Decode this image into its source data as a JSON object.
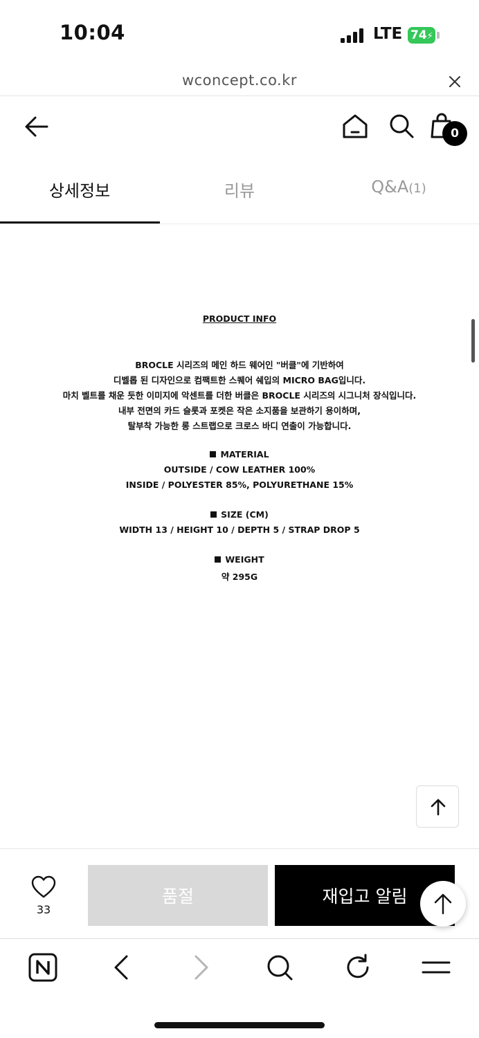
{
  "status_bar": {
    "time": "10:04",
    "network": "LTE",
    "battery": "74"
  },
  "browser": {
    "url": "wconcept.co.kr"
  },
  "header": {
    "cart_count": "0"
  },
  "tabs": [
    {
      "label": "상세정보",
      "active": true
    },
    {
      "label": "리뷰",
      "active": false
    },
    {
      "label": "Q&A",
      "count": "(1)",
      "active": false
    }
  ],
  "product_info": {
    "title": "PRODUCT INFO",
    "description": [
      "BROCLE 시리즈의 메인 하드 웨어인 \"버클\"에 기반하여",
      "디벨롭 된 디자인으로 컴팩트한 스퀘어 쉐입의 MICRO BAG입니다.",
      "마치 벨트를 채운 듯한 이미지에 악센트를 더한 버클은 BROCLE 시리즈의 시그니처 장식입니다.",
      "내부 전면의 카드 슬롯과 포켓은 작은 소지품을 보관하기 용이하며,",
      "탈부착 가능한 롱 스트랩으로 크로스 바디 연출이 가능합니다."
    ],
    "material": {
      "heading": "MATERIAL",
      "lines": [
        "OUTSIDE / COW LEATHER 100%",
        "INSIDE / POLYESTER 85%, POLYURETHANE 15%"
      ]
    },
    "size": {
      "heading": "SIZE (CM)",
      "lines": [
        "WIDTH 13 / HEIGHT 10 / DEPTH 5 / STRAP DROP 5"
      ]
    },
    "weight": {
      "heading": "WEIGHT",
      "lines": [
        "약 295G"
      ]
    }
  },
  "buy_bar": {
    "like_count": "33",
    "soldout_label": "품절",
    "restock_label": "재입고 알림"
  },
  "toolbar_icons": [
    "naver-icon",
    "back-arrow-icon",
    "forward-arrow-icon",
    "search-icon",
    "refresh-icon",
    "menu-icon"
  ]
}
